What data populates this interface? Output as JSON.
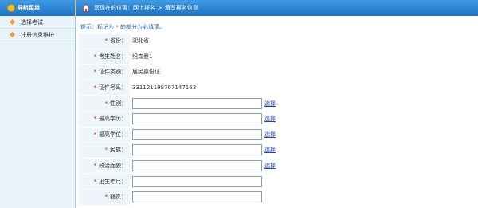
{
  "nav": {
    "title": "导航菜单",
    "items": [
      {
        "label": "选择考试"
      },
      {
        "label": "注册信息维护"
      }
    ]
  },
  "breadcrumb": {
    "prefix": "您现在的位置：网上报名",
    "separator": ">",
    "current": "填写报名信息"
  },
  "tip": {
    "before": "提示：标记为",
    "star": "*",
    "after": "的部分为必填项。"
  },
  "form": {
    "required_mark": "*",
    "rows": [
      {
        "label": "省份：",
        "value": "湖北省"
      },
      {
        "label": "考生姓名：",
        "value": "纪森曼1"
      },
      {
        "label": "证件类别：",
        "value": "居民身份证"
      },
      {
        "label": "证件号码：",
        "value": "331121198707147163"
      },
      {
        "label": "性别：",
        "input": "",
        "link": "选择"
      },
      {
        "label": "最高学历：",
        "input": "",
        "link": "选择"
      },
      {
        "label": "最高学位：",
        "input": "",
        "link": "选择"
      },
      {
        "label": "民族：",
        "input": "",
        "link": "选择"
      },
      {
        "label": "政治面貌：",
        "input": "",
        "link": "选择"
      },
      {
        "label": "出生年月：",
        "input": ""
      },
      {
        "label": "籍贯：",
        "input": ""
      }
    ]
  }
}
